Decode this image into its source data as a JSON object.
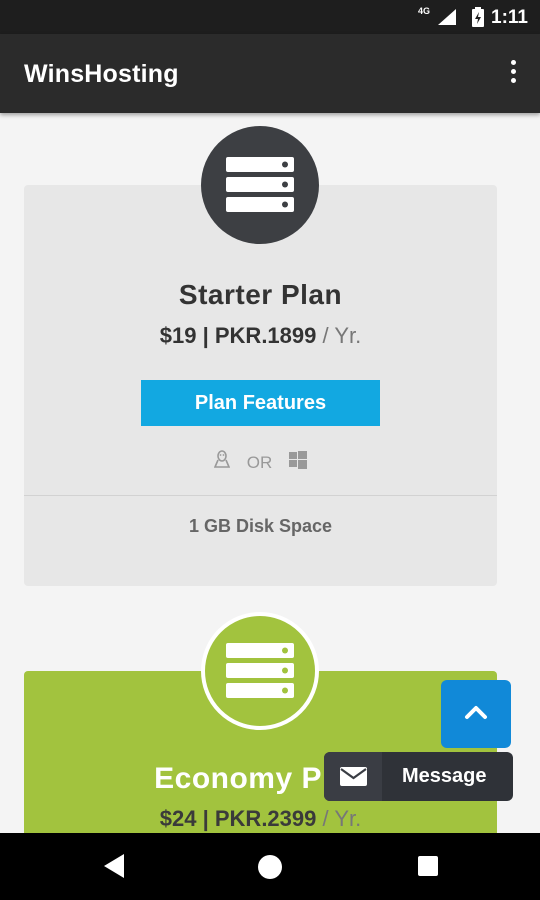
{
  "status_bar": {
    "network": "4G",
    "time": "1:11"
  },
  "app_bar": {
    "title": "WinsHosting",
    "menu_icon": "more-vert-icon"
  },
  "plans": [
    {
      "name": "Starter Plan",
      "price_usd": "$19",
      "price_sep": " | ",
      "price_pkr": "PKR.1899",
      "period": " / Yr.",
      "button_label": "Plan Features",
      "os_or": "OR",
      "feature": "1 GB Disk Space",
      "color": "#e7e7e7",
      "badge_color": "#3d3f43"
    },
    {
      "name": "Economy Plan",
      "price_usd": "$24",
      "price_sep": " | ",
      "price_pkr": "PKR.2399",
      "period": " / Yr.",
      "color": "#a2c33e",
      "badge_color": "#a2c33e"
    }
  ],
  "floating": {
    "scroll_top_icon": "chevron-up-icon",
    "message_label": "Message",
    "message_icon": "envelope-icon"
  },
  "colors": {
    "accent": "#12a8e1",
    "scroll_top": "#1189d8",
    "economy_green": "#a2c33e",
    "app_bar": "#2b2b2b"
  }
}
